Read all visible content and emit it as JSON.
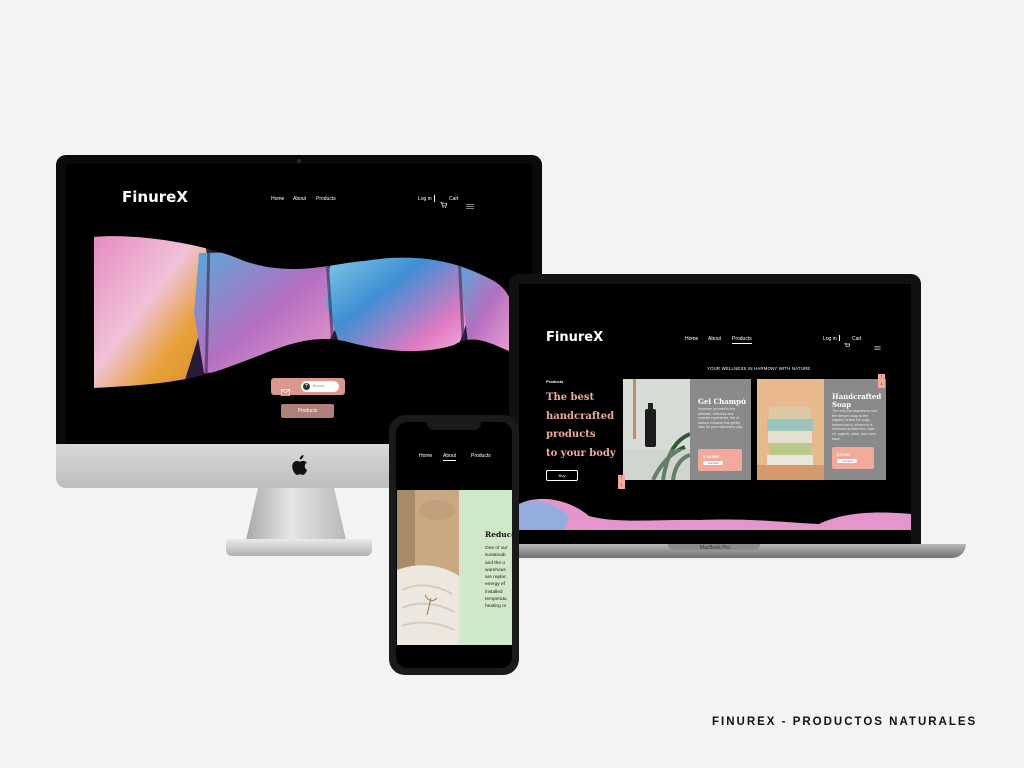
{
  "caption": "FINUREX - PRODUCTOS NATURALES",
  "brand": {
    "logo": "FinureX"
  },
  "nav": {
    "home": "Home",
    "about": "About",
    "products": "Products",
    "login": "Log in",
    "cart": "Cart"
  },
  "desktop": {
    "search_hint": "Buscar...",
    "products_button": "Products"
  },
  "laptop": {
    "tagline": "YOUR WELLNESS IN HARMONY WITH NATURE",
    "section_label": "Products",
    "headline": [
      "The best",
      "handcrafted",
      "products",
      "to your body"
    ],
    "cta": "Buy",
    "badge": "MacBook Pro",
    "cards": [
      {
        "title": "Gel Champú",
        "text": "Immerse yourself in the ultimate, delicious and smooth experience, full of natural extracts that gently care for your skin every day.",
        "price": "$ 18.000",
        "button": "Comprar"
      },
      {
        "title": "Handcrafted Soap",
        "text": "The only bar required to see the deeper soap to the organic herbal the soap, leaves that is infused in a minimum sulfate-free, bath oil, organic, plant, and calm base.",
        "price": "$ 9.000",
        "button": "Comprar"
      }
    ]
  },
  "phone": {
    "section_title": "Reduce",
    "body": [
      "One of our",
      "sustainab",
      "and the u",
      "warehous",
      "are replac",
      "energy ef",
      "installed",
      "temperatu",
      "heating or"
    ]
  },
  "colors": {
    "accent": "#d9978d",
    "price": "#f0a99b",
    "card": "#8a8a8a",
    "panel": "#cfe8c9"
  }
}
